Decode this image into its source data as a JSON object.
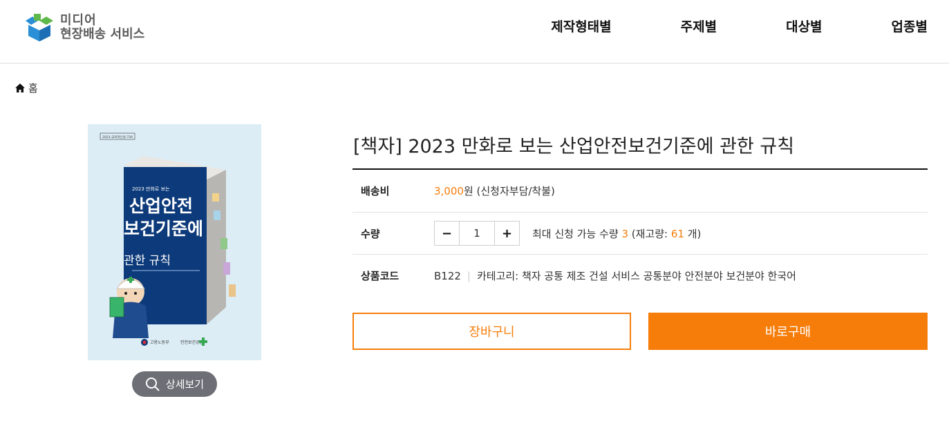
{
  "header": {
    "logo_line1": "미디어",
    "logo_line2": "현장배송 서비스",
    "nav": [
      "제작형태별",
      "주제별",
      "대상별",
      "업종별"
    ]
  },
  "breadcrumb": {
    "home_label": "홈"
  },
  "cover": {
    "top_tag": "2023-교육혁신실-726",
    "subtitle": "2023 만화로 보는",
    "title_line1": "산업안전",
    "title_line2": "보건기준에",
    "title_line3": "관한 규칙",
    "publisher1": "고용노동부",
    "publisher2": "안전보건공단"
  },
  "zoom_label": "상세보기",
  "product": {
    "title": "[책자] 2023 만화로 보는 산업안전보건기준에 관한 규칙",
    "shipping_label": "배송비",
    "shipping_price": "3,000",
    "shipping_unit": "원 (신청자부담/착불)",
    "qty_label": "수량",
    "qty_minus": "−",
    "qty_plus": "+",
    "qty_value": "1",
    "qty_note_prefix": "최대 신청 가능 수량 ",
    "qty_max": "3",
    "qty_note_mid": " (재고량: ",
    "stock": "61",
    "qty_note_suffix": " 개)",
    "code_label": "상품코드",
    "code": "B122",
    "category": "카테고리: 책자 공통 제조 건설 서비스 공통분야 안전분야 보건분야 한국어"
  },
  "buttons": {
    "cart": "장바구니",
    "buy": "바로구매"
  },
  "colors": {
    "accent": "#f77d0a",
    "navy": "#0d3a7a",
    "zoom_bg": "#6d6e76"
  }
}
